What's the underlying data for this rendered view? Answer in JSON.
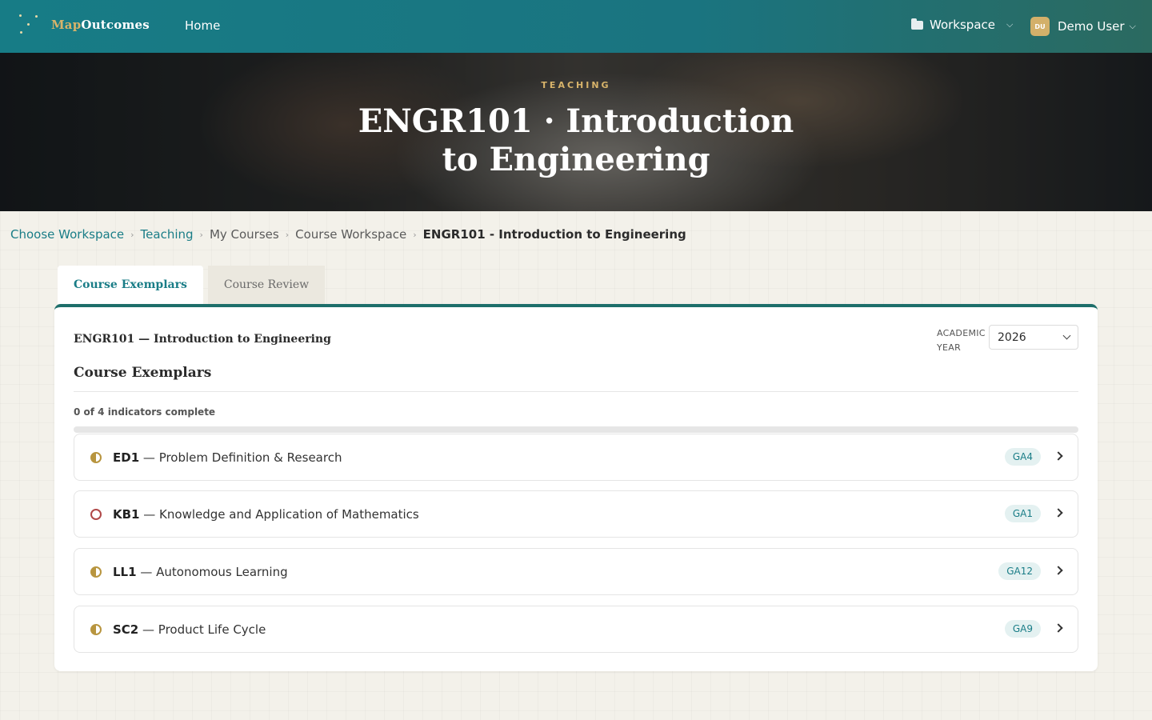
{
  "topbar": {
    "brand_prefix": "Map",
    "brand_suffix": "Outcomes",
    "home": "Home",
    "workspace": "Workspace",
    "user_initials": "DU",
    "user_name": "Demo User"
  },
  "hero": {
    "kicker": "TEACHING",
    "title": "ENGR101 · Introduction to Engineering"
  },
  "breadcrumb": [
    "Choose Workspace",
    "Teaching",
    "My Courses",
    "Course Workspace",
    "ENGR101 - Introduction to Engineering"
  ],
  "tabs": [
    "Course Exemplars",
    "Course Review"
  ],
  "card": {
    "course_title": "ENGR101 — Introduction to Engineering",
    "year_label": "ACADEMIC YEAR",
    "year_value": "2026",
    "section_title": "Course Exemplars",
    "progress_text": "0 of 4 indicators complete",
    "progress_fraction": 0
  },
  "indicators": [
    {
      "code": "ED1",
      "name": "— Problem Definition & Research",
      "badge": "GA4",
      "status": "partial"
    },
    {
      "code": "KB1",
      "name": "— Knowledge and Application of Mathematics",
      "badge": "GA1",
      "status": "empty"
    },
    {
      "code": "LL1",
      "name": "— Autonomous Learning",
      "badge": "GA12",
      "status": "partial"
    },
    {
      "code": "SC2",
      "name": "— Product Life Cycle",
      "badge": "GA9",
      "status": "partial"
    }
  ],
  "colors": {
    "accent": "#1a7d87",
    "gold": "#d7b36a",
    "partial_status": "#b8953f",
    "empty_status": "#b04848"
  }
}
